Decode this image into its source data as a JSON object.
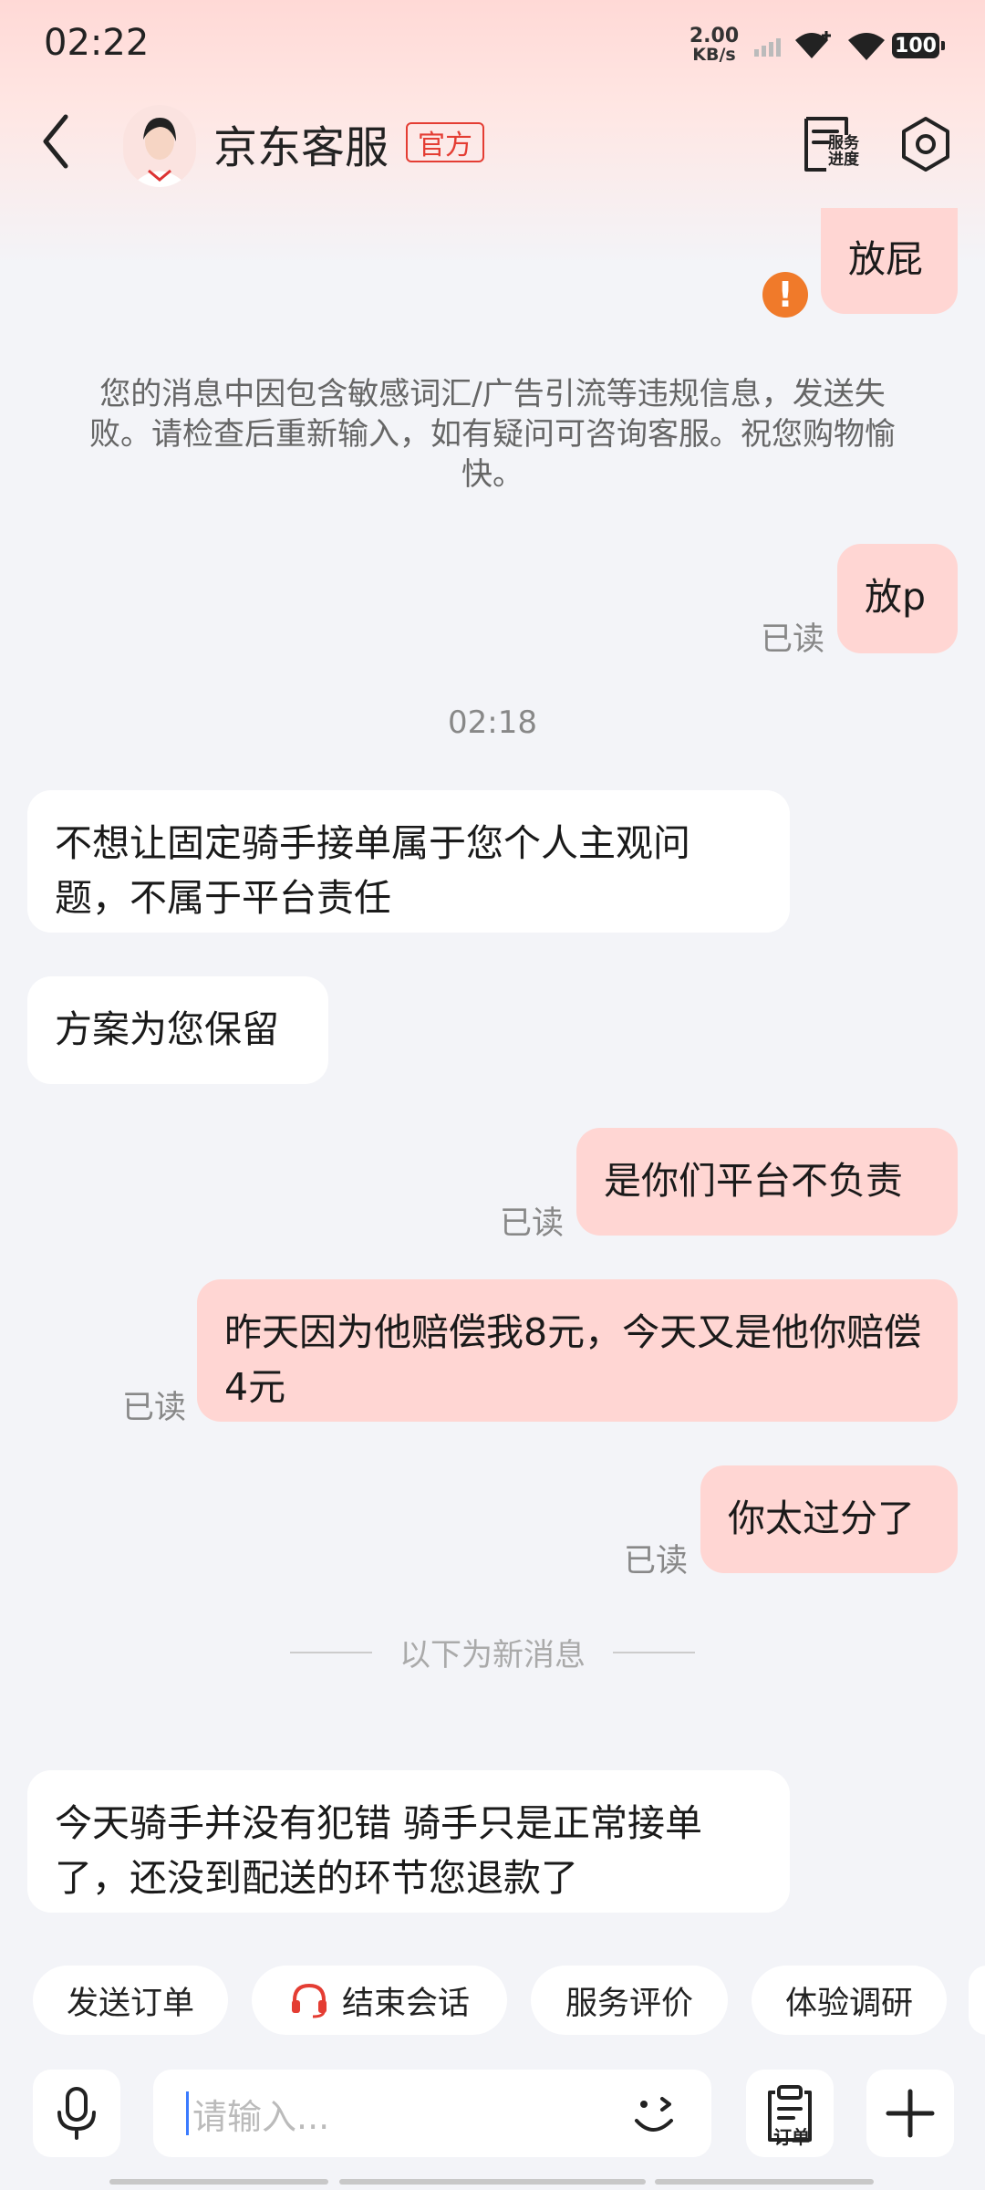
{
  "status": {
    "time": "02:22",
    "speed_value": "2.00",
    "speed_unit": "KB/s",
    "battery": "100"
  },
  "header": {
    "title": "京东客服",
    "badge": "官方",
    "service_line1": "服务",
    "service_line2": "进度"
  },
  "messages": {
    "m1": "放屁",
    "system_notice": "您的消息中因包含敏感词汇/广告引流等违规信息，发送失败。请检查后重新输入，如有疑问可咨询客服。祝您购物愉快。",
    "m2": "放p",
    "time": "02:18",
    "m3": "不想让固定骑手接单属于您个人主观问题，不属于平台责任",
    "m4": "方案为您保留",
    "m5": "是你们平台不负责",
    "m6": "昨天因为他赔偿我8元，今天又是他你赔偿4元",
    "m7": "你太过分了",
    "new_divider": "以下为新消息",
    "m8": "今天骑手并没有犯错  骑手只是正常接单了，还没到配送的环节您退款了"
  },
  "read_label": "已读",
  "quick_actions": [
    "发送订单",
    "结束会话",
    "服务评价",
    "体验调研"
  ],
  "input": {
    "placeholder": "请输入...",
    "order_label": "订单"
  },
  "colors": {
    "accent": "#e43d33",
    "my_bubble": "#ffd6d3",
    "warning": "#f07a2a"
  }
}
